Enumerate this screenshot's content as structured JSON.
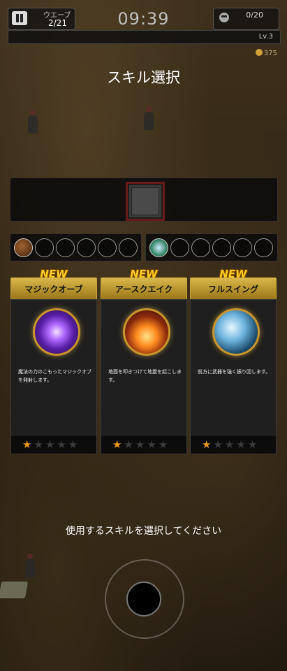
{
  "hud": {
    "wave_label": "ウエーブ",
    "wave_value": "2/21",
    "timer": "09:39",
    "kills": "0/20",
    "level": "Lv.3",
    "coins": "375"
  },
  "title": "スキル選択",
  "equip": {
    "weapon_slots": 6,
    "armor_slots": 6
  },
  "cards": [
    {
      "badge": "NEW",
      "name": "マジックオーブ",
      "description": "魔法の力のこもったマジックオブを発射します。",
      "stars": 1,
      "max_stars": 5
    },
    {
      "badge": "NEW",
      "name": "アースクエイク",
      "description": "地面を叩きつけて地震を起こします。",
      "stars": 1,
      "max_stars": 5
    },
    {
      "badge": "NEW",
      "name": "フルスイング",
      "description": "前方に武器を強く振り回します。",
      "stars": 1,
      "max_stars": 5
    }
  ],
  "prompt": "使用するスキルを選択してください",
  "colors": {
    "accent_gold": "#d9b74a",
    "star_on": "#f19a1e",
    "badge": "#ffcc22"
  }
}
